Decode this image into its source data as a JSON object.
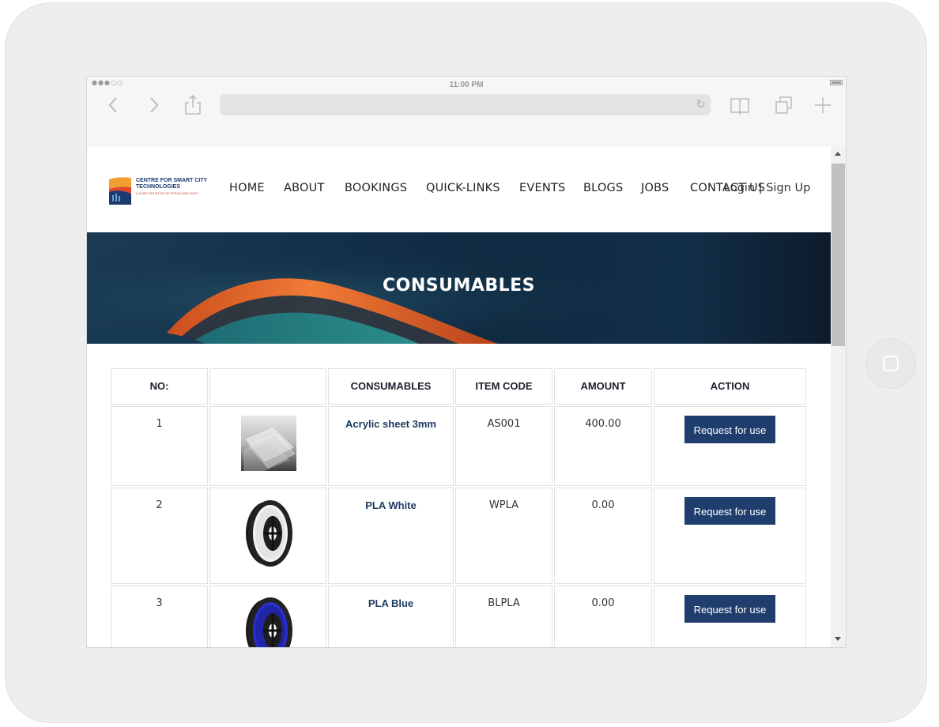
{
  "device": {
    "status_bar": {
      "signal": "●●●○○",
      "time": "11:00 PM"
    }
  },
  "browser": {
    "back_icon": "chevron-left",
    "forward_icon": "chevron-right",
    "share_icon": "share",
    "bookmarks_icon": "book",
    "tabs_icon": "tabs",
    "new_tab_icon": "plus",
    "address_value": ""
  },
  "site": {
    "logo": {
      "line1": "CENTRE FOR SMART CITY",
      "line2": "TECHNOLOGIES",
      "tagline": "A JOINT INITIATIVE OF DTEAG AND RGET"
    },
    "nav": [
      "HOME",
      "ABOUT",
      "BOOKINGS",
      "QUICK-LINKS",
      "EVENTS",
      "BLOGS",
      "JOBS",
      "CONTACT US"
    ],
    "auth_label": "Login | Sign Up",
    "banner_title": "CONSUMABLES"
  },
  "table": {
    "headers": [
      "NO:",
      "",
      "CONSUMABLES",
      "ITEM CODE",
      "AMOUNT",
      "ACTION"
    ],
    "rows": [
      {
        "no": "1",
        "name": "Acrylic sheet 3mm",
        "code": "AS001",
        "amount": "400.00",
        "action": "Request for use",
        "image": "acrylic-sheet"
      },
      {
        "no": "2",
        "name": "PLA White",
        "code": "WPLA",
        "amount": "0.00",
        "action": "Request for use",
        "image": "white-filament-spool"
      },
      {
        "no": "3",
        "name": "PLA Blue",
        "code": "BLPLA",
        "amount": "0.00",
        "action": "Request for use",
        "image": "blue-filament-spool"
      }
    ]
  },
  "colors": {
    "brand_navy": "#1f3d6d",
    "banner_orange": "#e8612c",
    "banner_dark": "#0f2a41"
  }
}
